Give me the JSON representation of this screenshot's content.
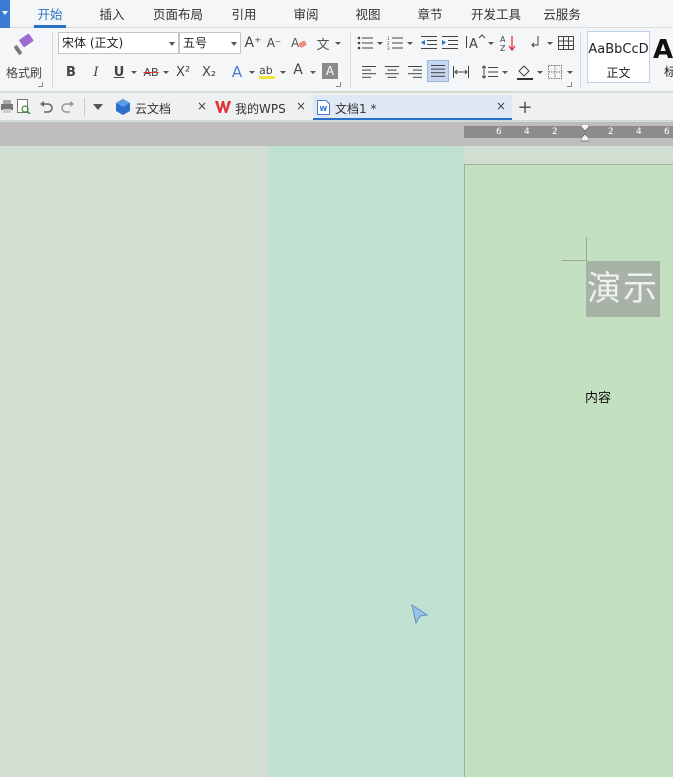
{
  "menu": {
    "tabs": [
      "开始",
      "插入",
      "页面布局",
      "引用",
      "审阅",
      "视图",
      "章节",
      "开发工具",
      "云服务"
    ],
    "active": "开始"
  },
  "ribbon": {
    "format_painter_label": "格式刷",
    "font_name": "宋体 (正文)",
    "font_size": "五号",
    "bold": "B",
    "italic": "I",
    "underline": "U",
    "strike": "AB",
    "superscript": "X²",
    "subscript": "X₂",
    "grow_font": "A⁺",
    "shrink_font": "A⁻",
    "font_color": "A",
    "char_shading": "A",
    "text_effect": "A",
    "wen": "文",
    "style_normal_sample": "AaBbCcD",
    "style_normal_name": "正文",
    "style_next_sample": "A",
    "style_next_name": "标"
  },
  "doc_tabs": [
    {
      "label": "云文档",
      "close": "×"
    },
    {
      "label": "我的WPS",
      "close": "×"
    },
    {
      "label": "文档1 *",
      "close": "×"
    }
  ],
  "new_tab": "+",
  "ruler_numbers": [
    "6",
    "4",
    "2",
    "2",
    "4",
    "6"
  ],
  "document": {
    "title_text": "演示",
    "body_text": "内容"
  },
  "colors": {
    "accent": "#2a6fc9",
    "workspace": "#d2ded2",
    "page": "#c3e0c0"
  }
}
